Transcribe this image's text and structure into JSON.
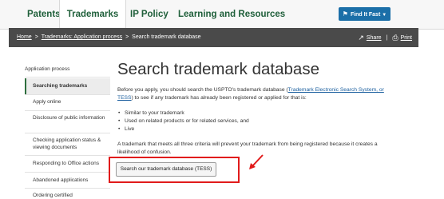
{
  "topnav": {
    "tabs": [
      {
        "label": "Patents",
        "active": false
      },
      {
        "label": "Trademarks",
        "active": true
      },
      {
        "label": "IP Policy",
        "active": false
      },
      {
        "label": "Learning and Resources",
        "active": false
      }
    ],
    "find_button": {
      "label": "Find It Fast",
      "icon": "tag-icon"
    }
  },
  "breadcrumb": {
    "items": [
      "Home",
      "Trademarks: Application process"
    ],
    "current": "Search trademark database"
  },
  "tools": {
    "share_label": "Share",
    "print_label": "Print",
    "separator": "|"
  },
  "sidebar": {
    "heading": "Application process",
    "items": [
      {
        "label": "Searching trademarks",
        "active": true
      },
      {
        "label": "Apply online",
        "active": false
      },
      {
        "label": "Disclosure of public information",
        "active": false
      },
      {
        "label": "Checking application status & viewing documents",
        "active": false
      },
      {
        "label": "Responding to Office actions",
        "active": false
      },
      {
        "label": "Abandoned applications",
        "active": false
      },
      {
        "label": "Ordering certified",
        "active": false
      }
    ]
  },
  "main": {
    "title": "Search trademark database",
    "intro_before": "Before you apply, you should search the USPTO's trademark database (",
    "intro_link": "Trademark Electronic Search System, or TESS",
    "intro_after": ") to see if any trademark has already been registered or applied for that is:",
    "bullets": [
      "Similar to your trademark",
      "Used on related products or for related services, and",
      "Live"
    ],
    "criteria_text": "A trademark that meets all three criteria will prevent your trademark from being registered because it creates a likelihood of confusion.",
    "search_button_label": "Search our trademark database (TESS)"
  },
  "colors": {
    "brand_green": "#1f5f3a",
    "find_button_blue": "#1b6fa8",
    "breadcrumb_bar": "#4a4a4a",
    "link_blue": "#1b5f9f",
    "annotation_red": "#e11b1b"
  }
}
